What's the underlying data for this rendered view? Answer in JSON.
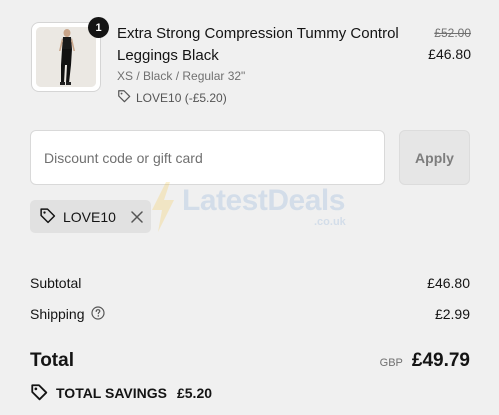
{
  "product": {
    "quantity": "1",
    "title": "Extra Strong Compression Tummy Control Leggings Black",
    "variant": "XS / Black / Regular 32\"",
    "discount_label": "LOVE10 (-£5.20)",
    "compare_price": "£52.00",
    "price": "£46.80",
    "image_icon": "leggings-product-image"
  },
  "discount": {
    "placeholder": "Discount code or gift card",
    "apply_label": "Apply",
    "applied_code": "LOVE10"
  },
  "watermark": {
    "text": "LatestDeals",
    "sub": ".co.uk"
  },
  "summary": {
    "subtotal_label": "Subtotal",
    "subtotal_value": "£46.80",
    "shipping_label": "Shipping",
    "shipping_value": "£2.99",
    "total_label": "Total",
    "currency": "GBP",
    "total_value": "£49.79",
    "savings_label": "TOTAL SAVINGS",
    "savings_value": "£5.20"
  },
  "colors": {
    "background": "#f0f0f0",
    "text": "#141414",
    "muted": "#707070",
    "tag_bg": "#e1e1e1",
    "watermark": "#6e9ed2",
    "watermark_bolt": "#f5c12e"
  }
}
